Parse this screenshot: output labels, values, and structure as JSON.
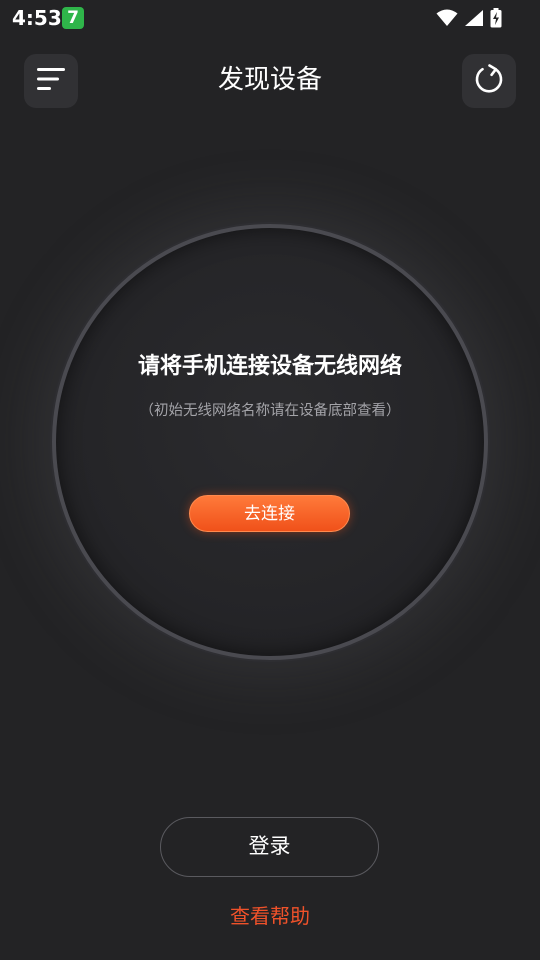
{
  "status_bar": {
    "time": "4:53",
    "app_badge": "7",
    "icons": [
      "wifi-icon",
      "cellular-signal-icon",
      "battery-charging-icon"
    ]
  },
  "header": {
    "title": "发现设备",
    "menu_icon": "menu-lines-icon",
    "refresh_icon": "refresh-icon"
  },
  "main": {
    "heading": "请将手机连接设备无线网络",
    "subtext": "（初始无线网络名称请在设备底部查看）",
    "connect_label": "去连接"
  },
  "footer": {
    "login_label": "登录",
    "help_label": "查看帮助"
  },
  "colors": {
    "background": "#232325",
    "accent": "#f0522a",
    "button_gradient_start": "#ff7a3a",
    "button_gradient_end": "#f0511a"
  }
}
